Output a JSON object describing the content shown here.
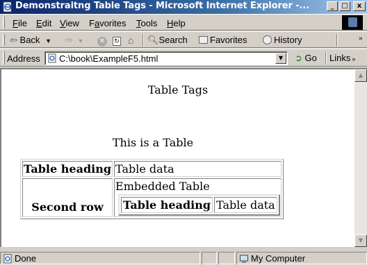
{
  "window": {
    "title": "Demonstraitng Table Tags - Microsoft Internet Explorer -...",
    "minimize": "_",
    "maximize": "□",
    "close": "x"
  },
  "menu": {
    "items": [
      "File",
      "Edit",
      "View",
      "Favorites",
      "Tools",
      "Help"
    ],
    "underline": [
      "F",
      "E",
      "V",
      "a",
      "T",
      "H"
    ]
  },
  "toolbar": {
    "back_label": "Back",
    "search_label": "Search",
    "favorites_label": "Favorites",
    "history_label": "History"
  },
  "address": {
    "label": "Address",
    "url": "C:\\book\\ExampleF5.html",
    "go_label": "Go",
    "links_label": "Links"
  },
  "page": {
    "heading": "Table Tags",
    "caption": "This is a Table",
    "table": {
      "row1_heading": "Table heading",
      "row1_data": "Table data",
      "row2_heading": "Second row",
      "embedded_caption": "Embedded Table",
      "inner_heading": "Table heading",
      "inner_data": "Table data"
    }
  },
  "status": {
    "text": "Done",
    "zone": "My Computer"
  },
  "colors": {
    "titlebar_start": "#0a246a",
    "titlebar_end": "#a6caf0",
    "chrome": "#d4d0c8"
  }
}
